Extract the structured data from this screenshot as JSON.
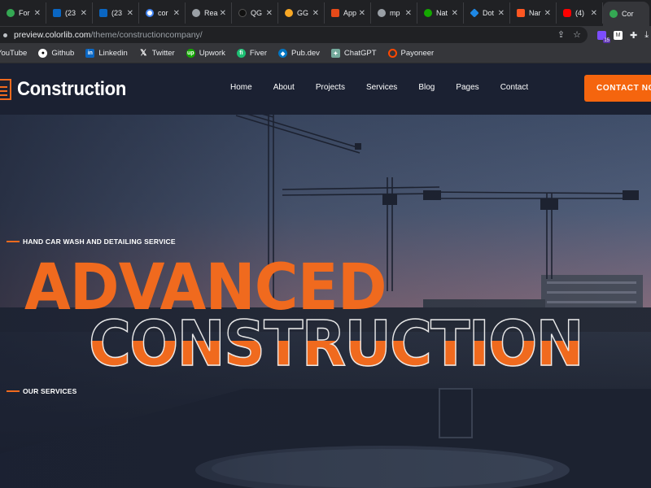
{
  "browser": {
    "tabs": [
      {
        "title": "For",
        "color": "#34a853"
      },
      {
        "title": "(23",
        "color": "#0a66c2"
      },
      {
        "title": "(23",
        "color": "#0a66c2"
      },
      {
        "title": "cor",
        "color": "#4285f4"
      },
      {
        "title": "Rea",
        "color": "#9aa0a6"
      },
      {
        "title": "QG",
        "color": "#111111"
      },
      {
        "title": "GG",
        "color": "#f9a825"
      },
      {
        "title": "App",
        "color": "#e64a19"
      },
      {
        "title": "mp",
        "color": "#9aa0a6"
      },
      {
        "title": "Nat",
        "color": "#14a800"
      },
      {
        "title": "Dot",
        "color": "#1e88e5"
      },
      {
        "title": "Nar",
        "color": "#ff5722"
      },
      {
        "title": "(4)",
        "color": "#ff0000"
      },
      {
        "title": "Cor",
        "color": "#34a853"
      }
    ],
    "url_host": "preview.colorlib.com",
    "url_path": "/theme/constructioncompany/",
    "bookmarks": [
      {
        "label": "YouTube",
        "color": "#ff0000",
        "glyph": "▶"
      },
      {
        "label": "Github",
        "color": "#ffffff",
        "glyph": "●"
      },
      {
        "label": "Linkedin",
        "color": "#0a66c2",
        "glyph": "in"
      },
      {
        "label": "Twitter",
        "color": "#000000",
        "glyph": "X"
      },
      {
        "label": "Upwork",
        "color": "#14a800",
        "glyph": "up"
      },
      {
        "label": "Fiver",
        "color": "#1dbf73",
        "glyph": "fi"
      },
      {
        "label": "Pub.dev",
        "color": "#0175c2",
        "glyph": "◆"
      },
      {
        "label": "ChatGPT",
        "color": "#74aa9c",
        "glyph": "✦"
      },
      {
        "label": "Payoneer",
        "color": "#ff4800",
        "glyph": "○"
      }
    ],
    "extension_badge": "15"
  },
  "site": {
    "brand": "Construction",
    "menu": [
      "Home",
      "About",
      "Projects",
      "Services",
      "Blog",
      "Pages",
      "Contact"
    ],
    "cta": "CONTACT NOW",
    "tagline": "HAND CAR WASH AND DETAILING SERVICE",
    "headline_1": "ADVANCED",
    "headline_2": "CONSTRUCTION",
    "services_label": "OUR SERVICES",
    "accent": "#f06a1e",
    "nav_bg": "#1b2132"
  }
}
